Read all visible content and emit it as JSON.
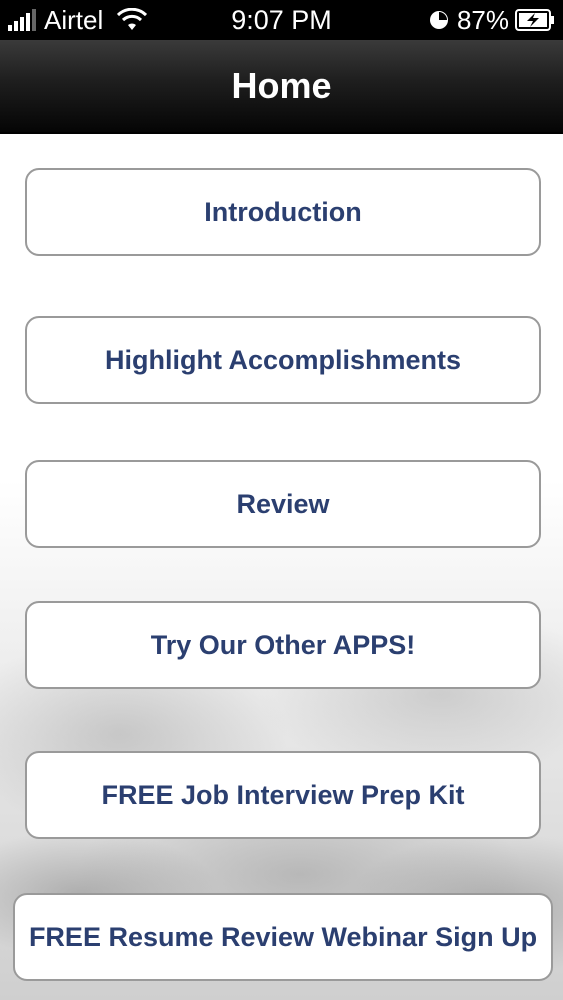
{
  "status_bar": {
    "carrier": "Airtel",
    "time": "9:07 PM",
    "battery_percent": "87%",
    "signal_bars": 4,
    "icons": [
      "signal-icon",
      "wifi-icon",
      "clock-icon",
      "battery-charging-icon"
    ]
  },
  "nav": {
    "title": "Home"
  },
  "menu": {
    "items": [
      {
        "label": "Introduction"
      },
      {
        "label": "Highlight Accomplishments"
      },
      {
        "label": "Review"
      },
      {
        "label": "Try Our Other APPS!"
      },
      {
        "label": "FREE Job Interview Prep Kit"
      },
      {
        "label": "FREE Resume Review Webinar Sign Up"
      }
    ]
  },
  "colors": {
    "button_text": "#2b3f70",
    "nav_background": "#111111",
    "button_border": "#9a9a9a"
  }
}
